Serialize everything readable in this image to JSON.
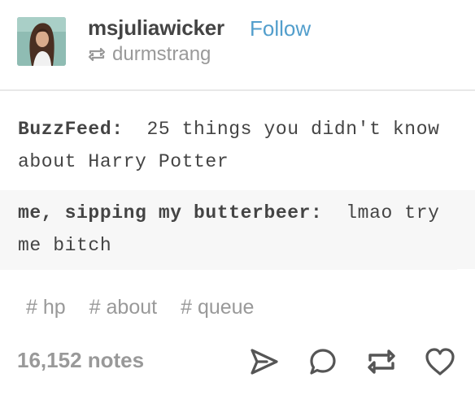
{
  "post": {
    "username": "msjuliawicker",
    "follow_label": "Follow",
    "reblogged_from": "durmstrang"
  },
  "chat": [
    {
      "speaker": "BuzzFeed:",
      "text": "25 things you didn't know about Harry Potter"
    },
    {
      "speaker": "me, sipping my butterbeer:",
      "text": "lmao try me bitch"
    }
  ],
  "tags": [
    "# hp",
    "# about",
    "# queue"
  ],
  "footer": {
    "notes": "16,152 notes",
    "icons": [
      "share-icon",
      "reply-icon",
      "reblog-icon",
      "like-icon"
    ]
  },
  "colors": {
    "link": "#529ecc",
    "muted": "#999999",
    "text": "#444444",
    "chat_highlight": "#f7f7f7",
    "icon": "#555555"
  }
}
